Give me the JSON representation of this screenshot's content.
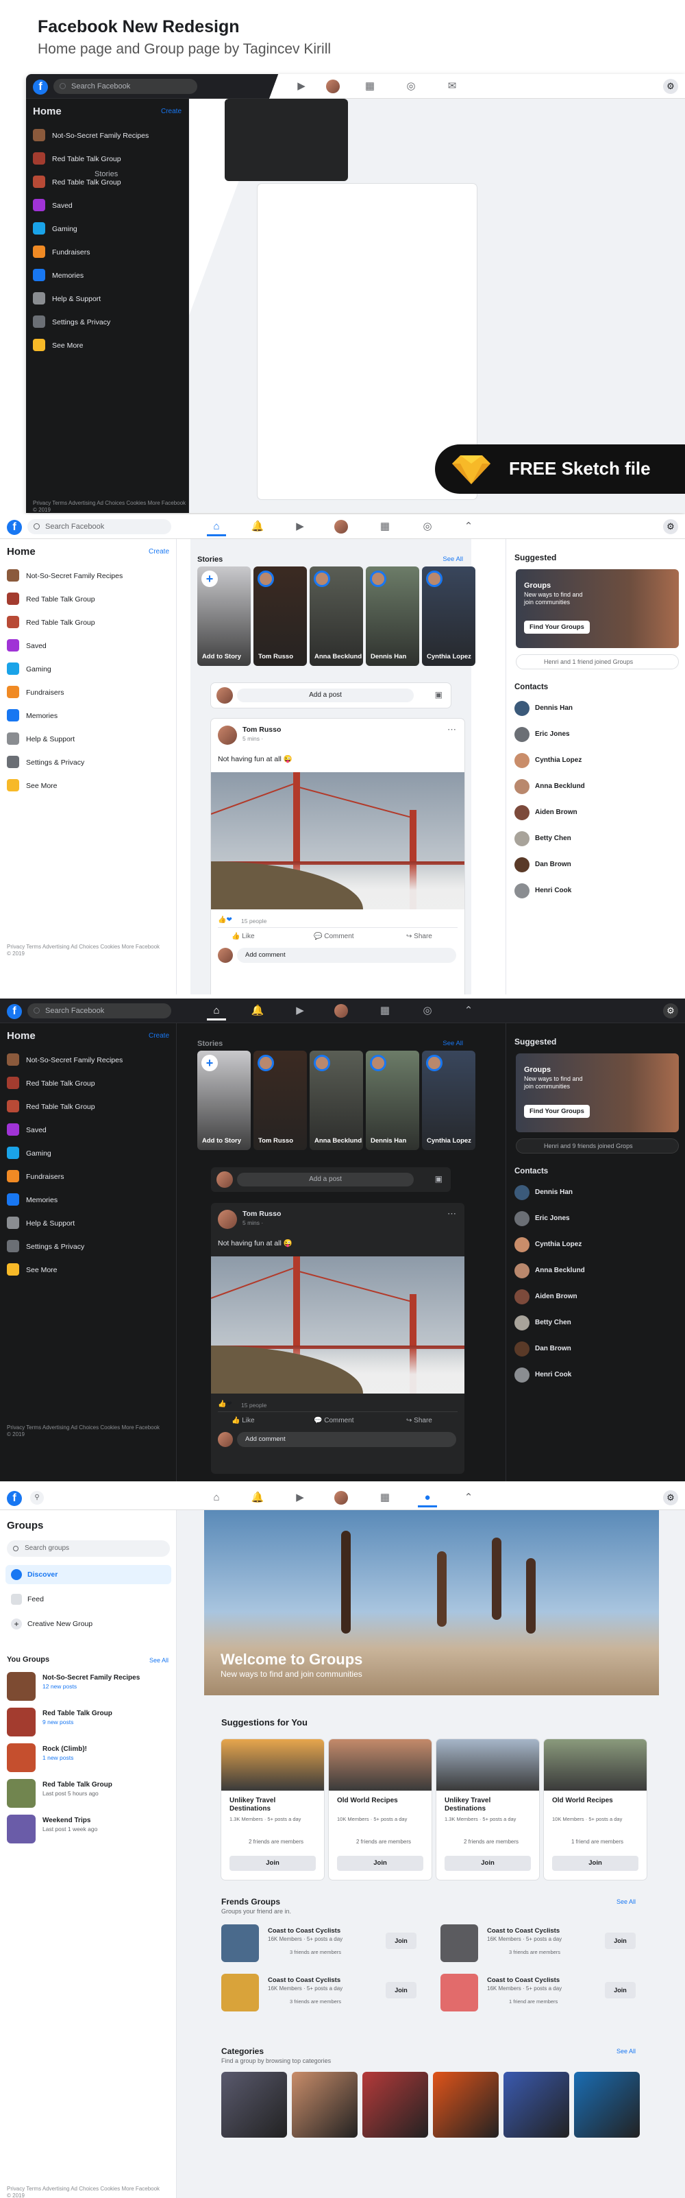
{
  "header": {
    "title": "Facebook New Redesign",
    "subtitle": "Home page and Group page by Tagincev Kirill"
  },
  "topbar": {
    "search_placeholder": "Search Facebook"
  },
  "sidebar": {
    "title": "Home",
    "create": "Create",
    "items": [
      {
        "label": "Not-So-Secret Family Recipes",
        "icon": "group-thumb-icon",
        "color": "#8b5a3c"
      },
      {
        "label": "Red Table Talk Group",
        "icon": "group-thumb-icon",
        "color": "#a33c2f"
      },
      {
        "label": "Red Table Talk Group",
        "icon": "group-thumb-icon",
        "color": "#b84a36"
      },
      {
        "label": "Saved",
        "icon": "bookmark-icon",
        "color": "#a033d6"
      },
      {
        "label": "Gaming",
        "icon": "gaming-icon",
        "color": "#1aa3e8"
      },
      {
        "label": "Fundraisers",
        "icon": "heart-icon",
        "color": "#f08a24"
      },
      {
        "label": "Memories",
        "icon": "clock-icon",
        "color": "#1877f2"
      },
      {
        "label": "Help & Support",
        "icon": "help-icon",
        "color": "#8a8d91"
      },
      {
        "label": "Settings & Privacy",
        "icon": "gear-icon",
        "color": "#6b6f75"
      },
      {
        "label": "See More",
        "icon": "see-more-icon",
        "color": "#f7b928"
      }
    ],
    "footer": "Privacy  Terms  Advertising  Ad Choices  Cookies  More  Facebook © 2019"
  },
  "stories": {
    "label": "Stories",
    "see_all": "See All",
    "items": [
      {
        "label": "Add to Story",
        "bg": "#c9c9cc"
      },
      {
        "label": "Tom Russo",
        "bg": "#3b2a22"
      },
      {
        "label": "Anna Becklund",
        "bg": "#5a5e55"
      },
      {
        "label": "Dennis Han",
        "bg": "#6c7c68"
      },
      {
        "label": "Cynthia Lopez",
        "bg": "#39465c"
      }
    ]
  },
  "composer": {
    "placeholder": "Add a post"
  },
  "post": {
    "author": "Tom Russo",
    "time": "5 mins ·",
    "text": "Not having fun at all 😜",
    "reactions": "15 people",
    "like": "Like",
    "comment": "Comment",
    "share": "Share",
    "comment_placeholder": "Add comment"
  },
  "right": {
    "suggested": "Suggested",
    "group_title": "Groups",
    "group_desc": "New ways to find and join communities",
    "group_button": "Find Your Groups",
    "joined_light": "Henri and 1 friend joined Groups",
    "joined_dark": "Henri and 9 friends joined Grops",
    "contacts_title": "Contacts",
    "contacts": [
      "Dennis Han",
      "Eric Jones",
      "Cynthia Lopez",
      "Anna Becklund",
      "Aiden Brown",
      "Betty Chen",
      "Dan Brown",
      "Henri Cook"
    ]
  },
  "sketch": {
    "label": "FREE Sketch file"
  },
  "groups_page": {
    "title": "Groups",
    "search_placeholder": "Search groups",
    "nav": [
      "Discover",
      "Feed",
      "Creative New Group"
    ],
    "your_groups": "You Groups",
    "see_all": "See All",
    "items": [
      {
        "name": "Not-So-Secret Family Recipes",
        "meta": "12 new posts",
        "color": "#7d4b32"
      },
      {
        "name": "Red Table Talk Group",
        "meta": "9 new posts",
        "color": "#a33c2f"
      },
      {
        "name": "Rock (Climb)!",
        "meta": "1 new posts",
        "color": "#c54f2e"
      },
      {
        "name": "Red Table Talk Group",
        "meta": "Last post 5 hours ago",
        "color": "#71854f"
      },
      {
        "name": "Weekend Trips",
        "meta": "Last post 1 week ago",
        "color": "#6a5ca8"
      }
    ],
    "footer": "Privacy  Terms  Advertising  Ad Choices  Cookies  More  Facebook © 2019",
    "hero_title": "Welcome to Groups",
    "hero_sub": "New ways to find and join communities",
    "suggestions_title": "Suggestions for You",
    "suggestions": [
      {
        "name": "Unlikey Travel Destinations",
        "meta": "1.3K Members · 5+ posts a day",
        "friends": "2 friends are members",
        "bg": "#e7a64d"
      },
      {
        "name": "Old World Recipes",
        "meta": "10K Members · 5+ posts a day",
        "friends": "2 friends are members",
        "bg": "#c48a6a"
      },
      {
        "name": "Unlikey Travel Destinations",
        "meta": "1.3K Members · 5+ posts a day",
        "friends": "2 friends are members",
        "bg": "#a6b6c9"
      },
      {
        "name": "Old World Recipes",
        "meta": "10K Members · 5+ posts a day",
        "friends": "1 friend are members",
        "bg": "#8a9a7c"
      }
    ],
    "join": "Join",
    "friends_title": "Frends Groups",
    "friends_sub": "Groups your friend are in.",
    "friend_groups": [
      {
        "name": "Coast to Coast Cyclists",
        "meta": "16K Members · 5+ posts a day",
        "friends": "3 friends are members",
        "bg": "#4a6a8c"
      },
      {
        "name": "Coast to Coast Cyclists",
        "meta": "16K Members · 5+ posts a day",
        "friends": "3 friends are members",
        "bg": "#5b5b5f"
      },
      {
        "name": "Coast to Coast Cyclists",
        "meta": "16K Members · 5+ posts a day",
        "friends": "3 friends are members",
        "bg": "#d9a33a"
      },
      {
        "name": "Coast to Coast Cyclists",
        "meta": "16K Members · 5+ posts a day",
        "friends": "1 friend are members",
        "bg": "#e26b6b"
      }
    ],
    "categories_title": "Categories",
    "categories_sub": "Find a group by browsing top categories",
    "categories": [
      "#5a5a6e",
      "#c98d6a",
      "#b53a3a",
      "#e0541a",
      "#3a5ab0",
      "#1a6db3"
    ]
  }
}
